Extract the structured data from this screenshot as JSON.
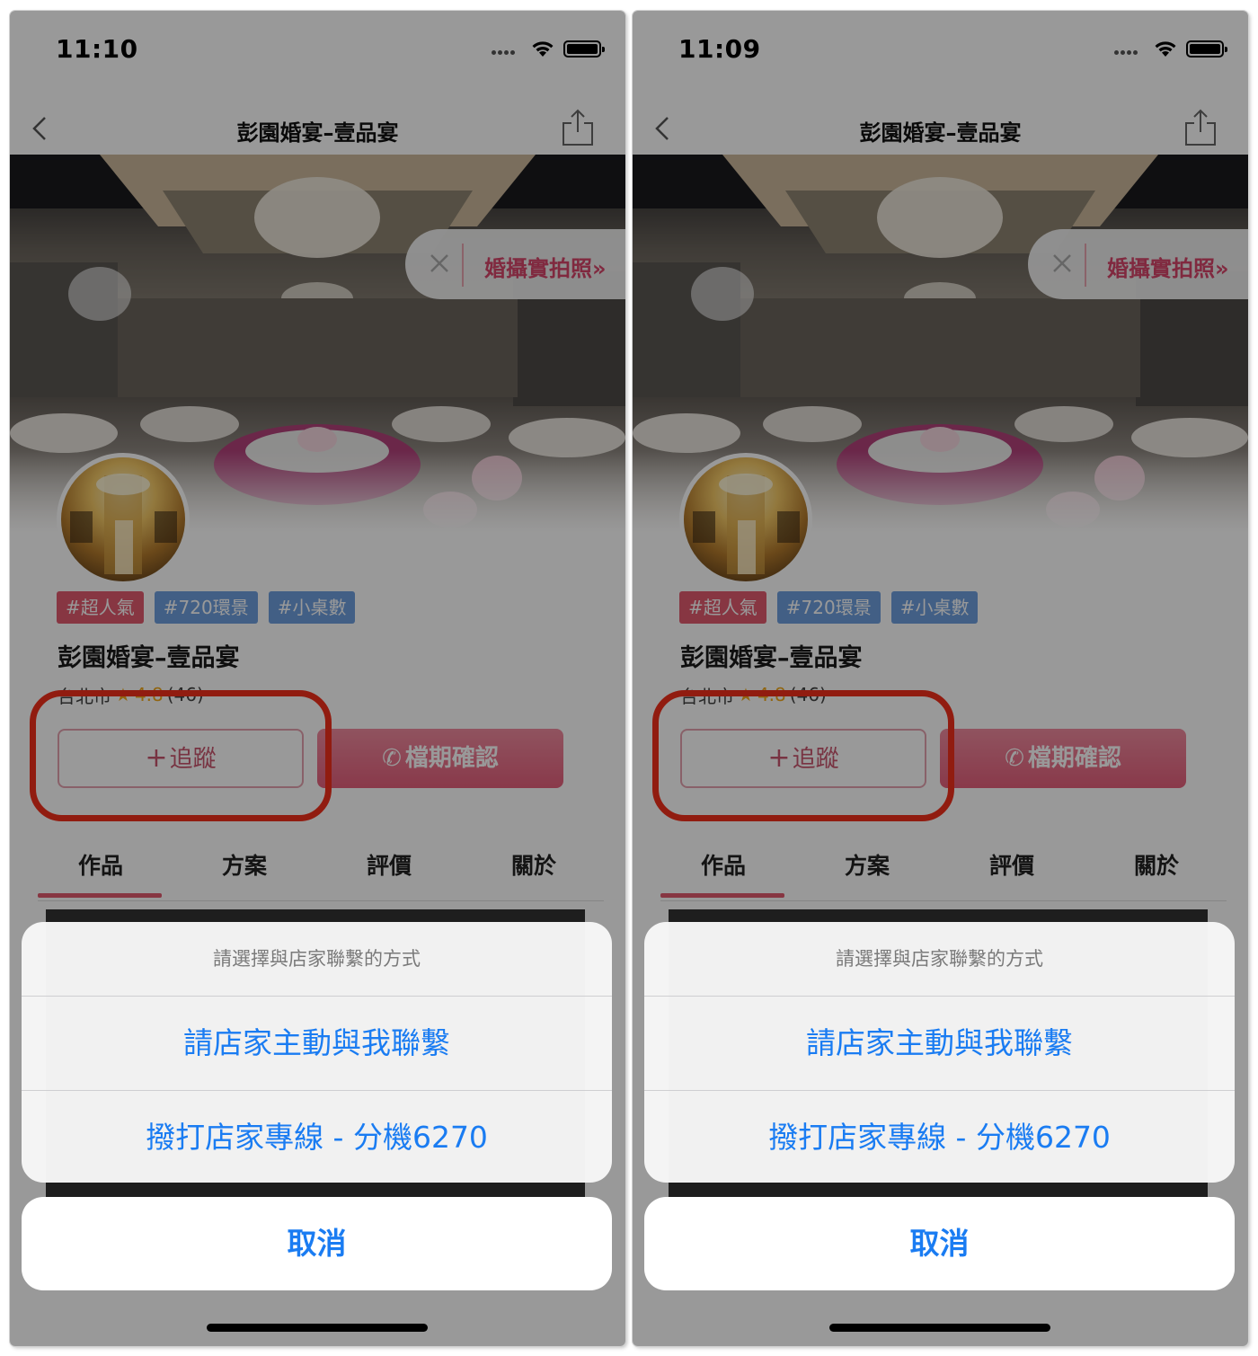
{
  "screens": [
    {
      "time": "11:10",
      "nav_title": "彭園婚宴–壹品宴",
      "photo_link": "婚攝實拍照»",
      "tags": [
        {
          "label": "#超人氣",
          "color": "#e25b6f"
        },
        {
          "label": "#720環景",
          "color": "#6e9fde"
        },
        {
          "label": "#小桌數",
          "color": "#6e9fde"
        }
      ],
      "venue_name": "彭園婚宴–壹品宴",
      "location": "台北市",
      "rating": "4.8",
      "review_count": "(46)",
      "follow_label": "追蹤",
      "booking_label": "檔期確認",
      "tabs": [
        "作品",
        "方案",
        "評價",
        "關於"
      ],
      "sheet_title": "請選擇與店家聯繫的方式",
      "option_contact_me": "請店家主動與我聯繫",
      "option_call": "撥打店家專線 - 分機6270",
      "cancel_label": "取消"
    },
    {
      "time": "11:09",
      "nav_title": "彭園婚宴–壹品宴",
      "photo_link": "婚攝實拍照»",
      "tags": [
        {
          "label": "#超人氣",
          "color": "#e25b6f"
        },
        {
          "label": "#720環景",
          "color": "#6e9fde"
        },
        {
          "label": "#小桌數",
          "color": "#6e9fde"
        }
      ],
      "venue_name": "彭園婚宴–壹品宴",
      "location": "台北市",
      "rating": "4.8",
      "review_count": "(46)",
      "follow_label": "追蹤",
      "booking_label": "檔期確認",
      "tabs": [
        "作品",
        "方案",
        "評價",
        "關於"
      ],
      "sheet_title": "請選擇與店家聯繫的方式",
      "option_contact_me": "請店家主動與我聯繫",
      "option_call": "撥打店家專線 - 分機6270",
      "cancel_label": "取消"
    }
  ],
  "colors": {
    "accent_pink": "#e25b6f",
    "ios_blue": "#1a7cf2",
    "annotation_red": "#f2301b",
    "tag_blue": "#6e9fde"
  }
}
